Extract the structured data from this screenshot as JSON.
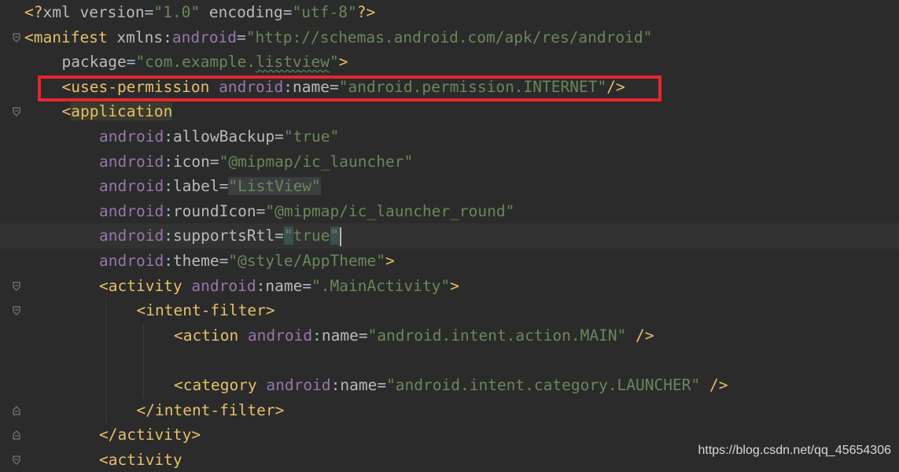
{
  "editor": {
    "lines": [
      {
        "indent": 0,
        "segments": [
          {
            "t": "<?",
            "c": "tag"
          },
          {
            "t": "xml ",
            "c": "attr"
          },
          {
            "t": "version",
            "c": "attr"
          },
          {
            "t": "=",
            "c": "pl"
          },
          {
            "t": "\"1.0\"",
            "c": "val"
          },
          {
            "t": " ",
            "c": "pl"
          },
          {
            "t": "encoding",
            "c": "attr"
          },
          {
            "t": "=",
            "c": "pl"
          },
          {
            "t": "\"utf-8\"",
            "c": "val"
          },
          {
            "t": "?>",
            "c": "tag"
          }
        ]
      },
      {
        "indent": 0,
        "fold": "open",
        "segments": [
          {
            "t": "<manifest ",
            "c": "tag"
          },
          {
            "t": "xmlns:",
            "c": "attr"
          },
          {
            "t": "android",
            "c": "ns"
          },
          {
            "t": "=",
            "c": "pl"
          },
          {
            "t": "\"http://schemas.android.com/apk/res/android\"",
            "c": "val"
          }
        ]
      },
      {
        "indent": 1,
        "segments": [
          {
            "t": "package",
            "c": "attr"
          },
          {
            "t": "=",
            "c": "pl"
          },
          {
            "t": "\"com.example.",
            "c": "val"
          },
          {
            "t": "listview",
            "c": "val typo"
          },
          {
            "t": "\"",
            "c": "val"
          },
          {
            "t": ">",
            "c": "tag"
          }
        ]
      },
      {
        "indent": 1,
        "segments": [
          {
            "t": "<uses-permission ",
            "c": "tag"
          },
          {
            "t": "android",
            "c": "ns"
          },
          {
            "t": ":",
            "c": "pl"
          },
          {
            "t": "name",
            "c": "attr"
          },
          {
            "t": "=",
            "c": "pl"
          },
          {
            "t": "\"android.permission.INTERNET\"",
            "c": "val"
          },
          {
            "t": "/>",
            "c": "tag"
          }
        ]
      },
      {
        "indent": 1,
        "fold": "open",
        "segments": [
          {
            "t": "<",
            "c": "tag"
          },
          {
            "t": "application",
            "c": "tag hl-app"
          }
        ]
      },
      {
        "indent": 2,
        "segments": [
          {
            "t": "android",
            "c": "ns"
          },
          {
            "t": ":",
            "c": "pl"
          },
          {
            "t": "allowBackup",
            "c": "attr"
          },
          {
            "t": "=",
            "c": "pl"
          },
          {
            "t": "\"true\"",
            "c": "val"
          }
        ]
      },
      {
        "indent": 2,
        "segments": [
          {
            "t": "android",
            "c": "ns"
          },
          {
            "t": ":",
            "c": "pl"
          },
          {
            "t": "icon",
            "c": "attr"
          },
          {
            "t": "=",
            "c": "pl"
          },
          {
            "t": "\"@mipmap/ic_launcher\"",
            "c": "val"
          }
        ]
      },
      {
        "indent": 2,
        "segments": [
          {
            "t": "android",
            "c": "ns"
          },
          {
            "t": ":",
            "c": "pl"
          },
          {
            "t": "label",
            "c": "attr"
          },
          {
            "t": "=",
            "c": "pl"
          },
          {
            "t": "\"ListView\"",
            "c": "val hl-val"
          }
        ]
      },
      {
        "indent": 2,
        "segments": [
          {
            "t": "android",
            "c": "ns"
          },
          {
            "t": ":",
            "c": "pl"
          },
          {
            "t": "roundIcon",
            "c": "attr"
          },
          {
            "t": "=",
            "c": "pl"
          },
          {
            "t": "\"@mipmap/ic_launcher_round\"",
            "c": "val"
          }
        ]
      },
      {
        "indent": 2,
        "current": true,
        "caret": true,
        "segments": [
          {
            "t": "android",
            "c": "ns"
          },
          {
            "t": ":",
            "c": "pl"
          },
          {
            "t": "supportsRtl",
            "c": "attr"
          },
          {
            "t": "=",
            "c": "pl"
          },
          {
            "t": "\"",
            "c": "val hl-quote"
          },
          {
            "t": "true",
            "c": "val"
          },
          {
            "t": "\"",
            "c": "val hl-quote"
          }
        ]
      },
      {
        "indent": 2,
        "segments": [
          {
            "t": "android",
            "c": "ns"
          },
          {
            "t": ":",
            "c": "pl"
          },
          {
            "t": "theme",
            "c": "attr"
          },
          {
            "t": "=",
            "c": "pl"
          },
          {
            "t": "\"@style/AppTheme\"",
            "c": "val"
          },
          {
            "t": ">",
            "c": "tag"
          }
        ]
      },
      {
        "indent": 2,
        "fold": "open",
        "segments": [
          {
            "t": "<activity ",
            "c": "tag"
          },
          {
            "t": "android",
            "c": "ns"
          },
          {
            "t": ":",
            "c": "pl"
          },
          {
            "t": "name",
            "c": "attr"
          },
          {
            "t": "=",
            "c": "pl"
          },
          {
            "t": "\".MainActivity\"",
            "c": "val"
          },
          {
            "t": ">",
            "c": "tag"
          }
        ]
      },
      {
        "indent": 3,
        "fold": "open",
        "segments": [
          {
            "t": "<intent-filter>",
            "c": "tag"
          }
        ]
      },
      {
        "indent": 4,
        "segments": [
          {
            "t": "<action ",
            "c": "tag"
          },
          {
            "t": "android",
            "c": "ns"
          },
          {
            "t": ":",
            "c": "pl"
          },
          {
            "t": "name",
            "c": "attr"
          },
          {
            "t": "=",
            "c": "pl"
          },
          {
            "t": "\"android.intent.action.MAIN\"",
            "c": "val"
          },
          {
            "t": " />",
            "c": "tag"
          }
        ]
      },
      {
        "indent": 4,
        "segments": []
      },
      {
        "indent": 4,
        "segments": [
          {
            "t": "<category ",
            "c": "tag"
          },
          {
            "t": "android",
            "c": "ns"
          },
          {
            "t": ":",
            "c": "pl"
          },
          {
            "t": "name",
            "c": "attr"
          },
          {
            "t": "=",
            "c": "pl"
          },
          {
            "t": "\"android.intent.category.LAUNCHER\"",
            "c": "val"
          },
          {
            "t": " />",
            "c": "tag"
          }
        ]
      },
      {
        "indent": 3,
        "fold": "close",
        "segments": [
          {
            "t": "</intent-filter>",
            "c": "tag"
          }
        ]
      },
      {
        "indent": 2,
        "fold": "close",
        "segments": [
          {
            "t": "</activity>",
            "c": "tag"
          }
        ]
      },
      {
        "indent": 2,
        "fold": "open",
        "segments": [
          {
            "t": "<activity",
            "c": "tag"
          }
        ]
      }
    ]
  },
  "watermark": "https://blog.csdn.net/qq_45654306"
}
